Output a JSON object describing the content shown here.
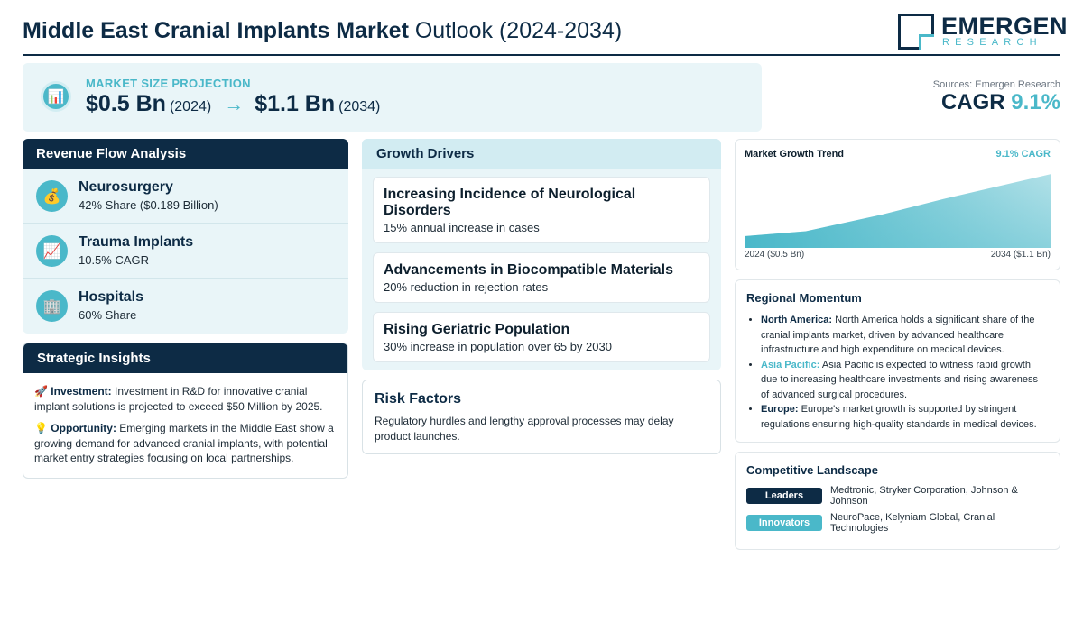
{
  "header": {
    "title_bold": "Middle East Cranial Implants Market",
    "title_rest": "Outlook (2024-2034)",
    "logo_name": "EMERGEN",
    "logo_sub": "RESEARCH"
  },
  "projection": {
    "icon": "bar-chart-icon",
    "label": "MARKET SIZE PROJECTION",
    "start_value": "$0.5 Bn",
    "start_year": "(2024)",
    "arrow": "→",
    "end_value": "$1.1 Bn",
    "end_year": "(2034)"
  },
  "sources": "Sources: Emergen Research",
  "cagr": {
    "label": "CAGR",
    "value": "9.1%"
  },
  "revenue_flow": {
    "title": "Revenue Flow Analysis",
    "items": [
      {
        "icon": "money-bag-icon",
        "glyph": "💰",
        "title": "Neurosurgery",
        "sub": "42% Share ($0.189 Billion)"
      },
      {
        "icon": "chart-increasing-icon",
        "glyph": "📈",
        "title": "Trauma Implants",
        "sub": "10.5% CAGR"
      },
      {
        "icon": "hospital-icon",
        "glyph": "🏢",
        "title": "Hospitals",
        "sub": "60% Share"
      }
    ]
  },
  "strategic": {
    "title": "Strategic Insights",
    "items": [
      {
        "glyph": "🚀",
        "label": "Investment:",
        "text": "Investment in R&D for innovative cranial implant solutions is projected to exceed $50 Million by 2025."
      },
      {
        "glyph": "💡",
        "label": "Opportunity:",
        "text": "Emerging markets in the Middle East show a growing demand for advanced cranial implants, with potential market entry strategies focusing on local partnerships."
      }
    ]
  },
  "drivers": {
    "title": "Growth Drivers",
    "items": [
      {
        "title": "Increasing Incidence of Neurological Disorders",
        "sub": "15% annual increase in cases"
      },
      {
        "title": "Advancements in Biocompatible Materials",
        "sub": "20% reduction in rejection rates"
      },
      {
        "title": "Rising Geriatric Population",
        "sub": "30% increase in population over 65 by 2030"
      }
    ]
  },
  "risk": {
    "title": "Risk Factors",
    "text": "Regulatory hurdles and lengthy approval processes may delay product launches."
  },
  "chart_data": {
    "type": "area",
    "title": "Market Growth Trend",
    "annotation": "9.1% CAGR",
    "x": [
      "2024",
      "2034"
    ],
    "series": [
      {
        "values": [
          0.5,
          1.1
        ]
      }
    ],
    "start_label": "2024 ($0.5 Bn)",
    "end_label": "2034 ($1.1 Bn)",
    "color": "#4ab8c9"
  },
  "regional": {
    "title": "Regional Momentum",
    "items": [
      {
        "label": "North America:",
        "style": "dark",
        "text": "North America holds a significant share of the cranial implants market, driven by advanced healthcare infrastructure and high expenditure on medical devices."
      },
      {
        "label": "Asia Pacific:",
        "style": "teal",
        "text": "Asia Pacific is expected to witness rapid growth due to increasing healthcare investments and rising awareness of advanced surgical procedures."
      },
      {
        "label": "Europe:",
        "style": "dark",
        "text": "Europe's market growth is supported by stringent regulations ensuring high-quality standards in medical devices."
      }
    ]
  },
  "competitive": {
    "title": "Competitive Landscape",
    "leaders_label": "Leaders",
    "leaders": "Medtronic, Stryker Corporation, Johnson & Johnson",
    "innovators_label": "Innovators",
    "innovators": "NeuroPace, Kelyniam Global, Cranial Technologies"
  },
  "colors": {
    "navy": "#0d2b45",
    "teal": "#4ab8c9",
    "light_bg": "#e9f5f8"
  }
}
